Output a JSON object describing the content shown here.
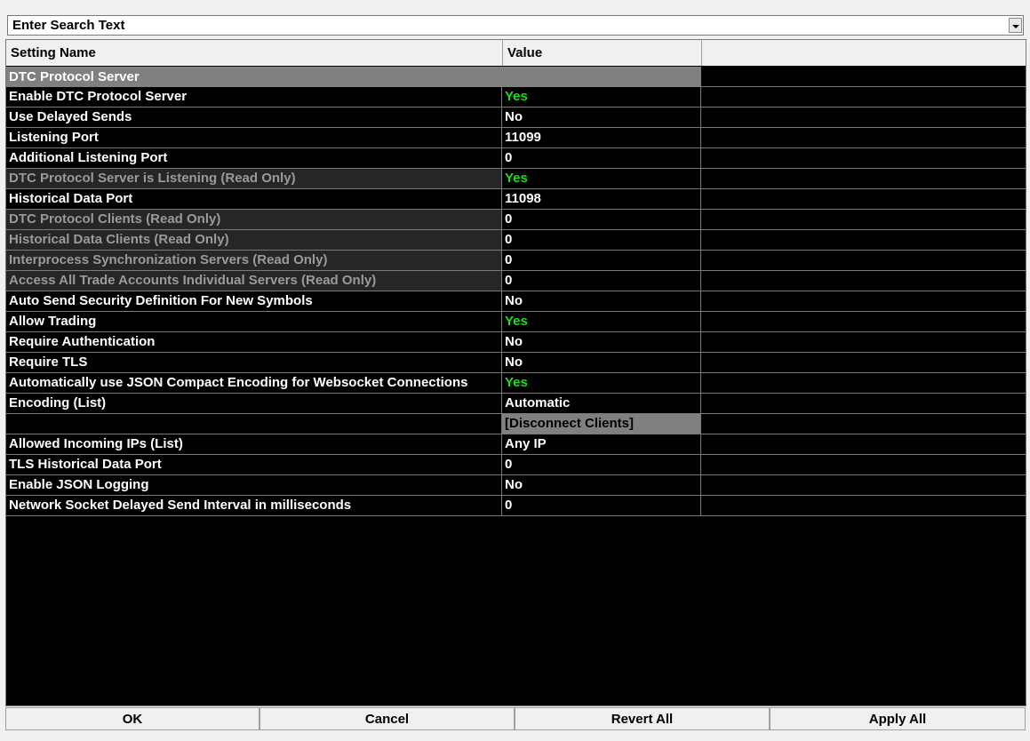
{
  "search": {
    "placeholder": "Enter Search Text"
  },
  "table": {
    "columns": [
      "Setting Name",
      "Value"
    ],
    "rows": [
      {
        "name": "DTC Protocol Server",
        "value": "",
        "kind": "section"
      },
      {
        "name": "Enable DTC Protocol Server",
        "value": "Yes",
        "kind": "normal"
      },
      {
        "name": "Use Delayed Sends",
        "value": "No",
        "kind": "normal"
      },
      {
        "name": "Listening Port",
        "value": "11099",
        "kind": "normal"
      },
      {
        "name": "Additional Listening Port",
        "value": "0",
        "kind": "normal"
      },
      {
        "name": "DTC Protocol Server is Listening (Read Only)",
        "value": "Yes",
        "kind": "readonly"
      },
      {
        "name": "Historical Data Port",
        "value": "11098",
        "kind": "normal"
      },
      {
        "name": "DTC Protocol Clients (Read Only)",
        "value": "0",
        "kind": "readonly"
      },
      {
        "name": "Historical Data Clients (Read Only)",
        "value": "0",
        "kind": "readonly"
      },
      {
        "name": "Interprocess Synchronization Servers (Read Only)",
        "value": "0",
        "kind": "readonly"
      },
      {
        "name": "Access All Trade Accounts Individual Servers (Read Only)",
        "value": "0",
        "kind": "readonly"
      },
      {
        "name": "Auto Send Security Definition For New Symbols",
        "value": "No",
        "kind": "normal"
      },
      {
        "name": "Allow Trading",
        "value": "Yes",
        "kind": "normal"
      },
      {
        "name": "Require Authentication",
        "value": "No",
        "kind": "normal"
      },
      {
        "name": "Require TLS",
        "value": "No",
        "kind": "normal"
      },
      {
        "name": "Automatically use JSON Compact Encoding for Websocket Connections",
        "value": "Yes",
        "kind": "normal"
      },
      {
        "name": "Encoding (List)",
        "value": "Automatic",
        "kind": "normal"
      },
      {
        "name": " (Button)",
        "value": "[Disconnect Clients]",
        "kind": "button"
      },
      {
        "name": "Allowed Incoming IPs (List)",
        "value": "Any IP",
        "kind": "normal"
      },
      {
        "name": "TLS Historical Data Port",
        "value": "0",
        "kind": "normal"
      },
      {
        "name": "Enable JSON Logging",
        "value": "No",
        "kind": "normal"
      },
      {
        "name": "Network Socket Delayed Send Interval in milliseconds",
        "value": "0",
        "kind": "normal"
      }
    ]
  },
  "buttons": {
    "ok": "OK",
    "cancel": "Cancel",
    "revert_all": "Revert All",
    "apply_all": "Apply All"
  },
  "colors": {
    "yes_value": "#19e019",
    "section_bg": "#808080",
    "readonly_text": "#9a9a9a",
    "grid_bg": "#000000"
  }
}
